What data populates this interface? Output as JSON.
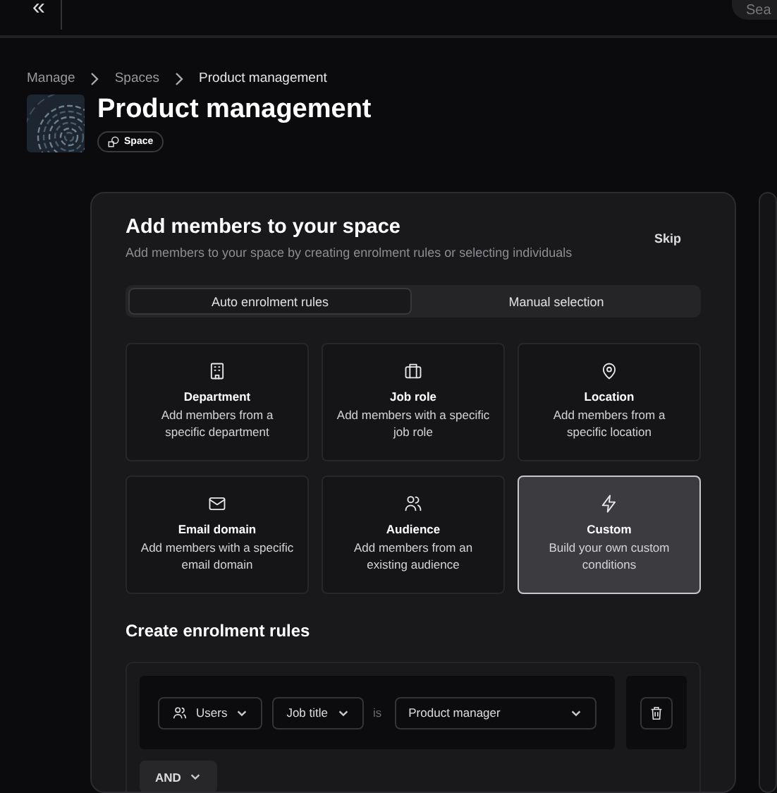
{
  "topbar": {
    "collapse": "«",
    "search": {
      "placeholder": "Sea"
    }
  },
  "breadcrumb": [
    {
      "label": "Manage",
      "current": false
    },
    {
      "label": "Spaces",
      "current": false
    },
    {
      "label": "Product management",
      "current": true
    }
  ],
  "page": {
    "title": "Product management",
    "badge": "Space"
  },
  "card": {
    "title": "Add members to your space",
    "subtitle": "Add members to your space by creating enrolment rules or selecting individuals",
    "skip": "Skip",
    "tabs": [
      {
        "label": "Auto enrolment rules",
        "selected": true
      },
      {
        "label": "Manual selection",
        "selected": false
      }
    ],
    "options": [
      {
        "kind": "building",
        "title": "Department",
        "desc": "Add members from a specific department",
        "selected": false
      },
      {
        "kind": "briefcase",
        "title": "Job role",
        "desc": "Add members with a specific job role",
        "selected": false
      },
      {
        "kind": "pin",
        "title": "Location",
        "desc": "Add members from a specific location",
        "selected": false
      },
      {
        "kind": "mail",
        "title": "Email domain",
        "desc": "Add members with a specific email domain",
        "selected": false
      },
      {
        "kind": "people",
        "title": "Audience",
        "desc": "Add members from an existing audience",
        "selected": false
      },
      {
        "kind": "bolt",
        "title": "Custom",
        "desc": "Build your own custom conditions",
        "selected": true
      }
    ],
    "rules_title": "Create enrolment rules",
    "rule": {
      "subject": "Users",
      "field": "Job title",
      "operator": "is",
      "value": "Product manager"
    },
    "join": "AND"
  }
}
